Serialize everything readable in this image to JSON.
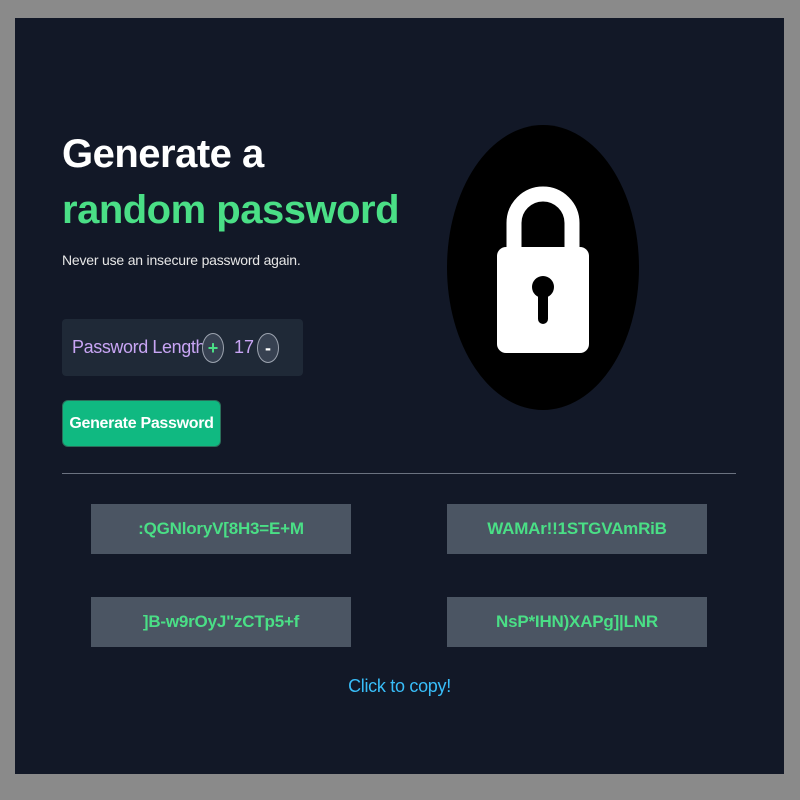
{
  "header": {
    "title_line1": "Generate a",
    "title_line2": "random password",
    "subtitle": "Never use an insecure password again."
  },
  "colors": {
    "background": "#121827",
    "accent_green": "#4adf86",
    "button_green": "#10b981",
    "label_purple": "#c8a5f4",
    "hint_blue": "#38bdf8",
    "password_box": "#4b5563"
  },
  "controls": {
    "length_label": "Password Length:",
    "increment_label": "+",
    "length_value": "17",
    "decrement_label": "-",
    "generate_button_label": "Generate Password"
  },
  "illustration": {
    "icon": "padlock-icon"
  },
  "passwords": [
    ":QGNloryV[8H3=E+M",
    "WAMAr!!1STGVAmRiB",
    "]B-w9rOyJ\"zCTp5+f",
    "NsP*IHN)XAPg]|LNR"
  ],
  "footer": {
    "copy_hint": "Click to copy!"
  }
}
